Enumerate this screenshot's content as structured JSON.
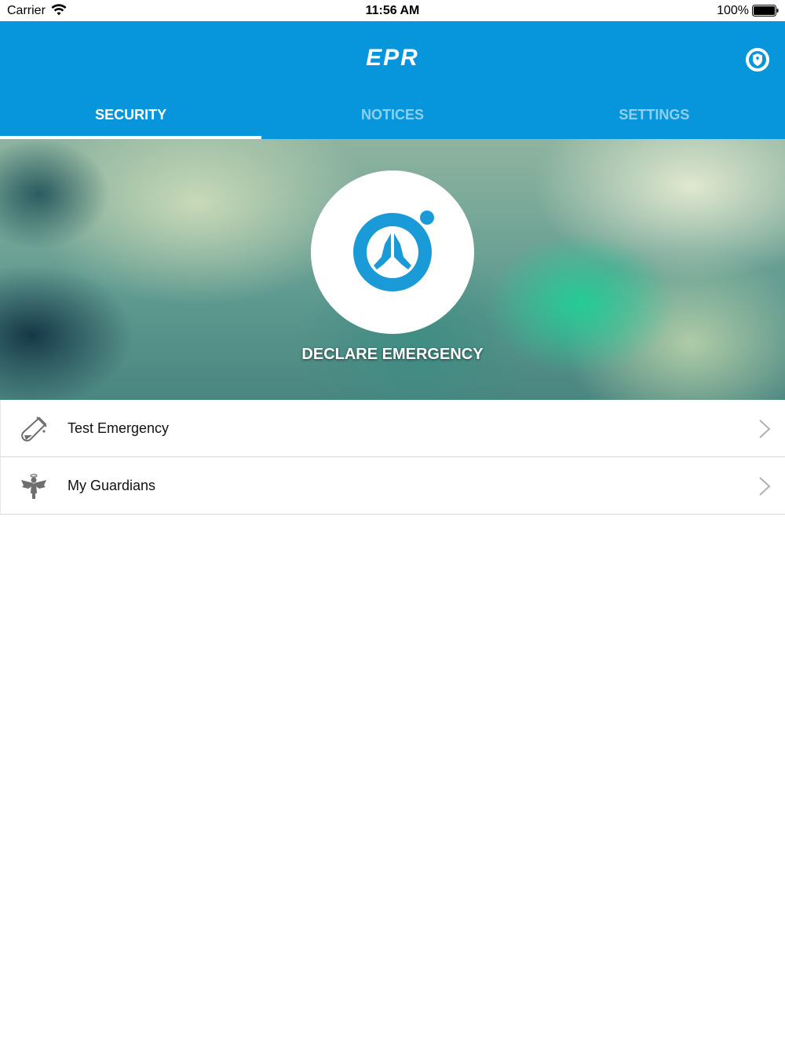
{
  "status_bar": {
    "carrier": "Carrier",
    "time": "11:56 AM",
    "battery": "100%"
  },
  "header": {
    "logo": "EPR",
    "shield_icon": "shield-icon"
  },
  "tabs": [
    {
      "label": "SECURITY",
      "active": true
    },
    {
      "label": "NOTICES",
      "active": false
    },
    {
      "label": "SETTINGS",
      "active": false
    }
  ],
  "hero": {
    "button_label": "DECLARE EMERGENCY",
    "icon": "praying-hands-icon"
  },
  "list": [
    {
      "label": "Test Emergency",
      "icon": "test-tube-icon"
    },
    {
      "label": "My Guardians",
      "icon": "angel-icon"
    }
  ],
  "colors": {
    "brand": "#0796db",
    "inactive_tab": "#8fd0f0",
    "accent_icon": "#1a9ad6"
  }
}
